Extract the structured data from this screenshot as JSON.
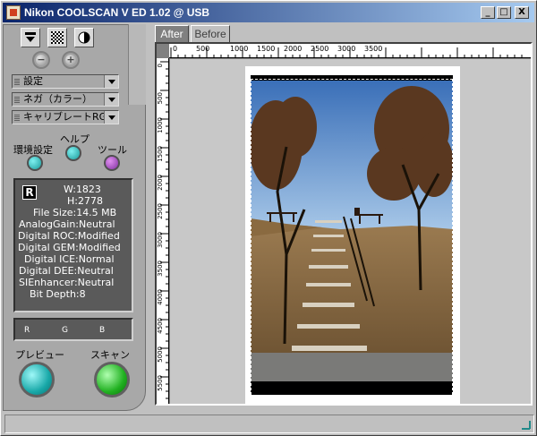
{
  "window": {
    "title": "Nikon COOLSCAN V ED 1.02 @ USB",
    "minimize": "_",
    "maximize": "□",
    "close": "X"
  },
  "panel": {
    "dropdowns": [
      "設定",
      "ネガ（カラー）",
      "キャリブレートRGB"
    ],
    "labels": {
      "env": "環境設定",
      "help": "ヘルプ",
      "tool": "ツール",
      "preview": "プレビュー",
      "scan": "スキャン"
    },
    "zoom_out": "−",
    "zoom_in": "+",
    "info": {
      "badge": "R",
      "w": "W:1823",
      "h": "H:2778",
      "file_size": "File Size:14.5 MB",
      "analog_gain": "AnalogGain:Neutral",
      "roc": "Digital ROC:Modified",
      "gem": "Digital GEM:Modified",
      "ice": "Digital ICE:Normal",
      "dee": "Digital DEE:Neutral",
      "sienhancer": "SIEnhancer:Neutral",
      "bit_depth": "Bit Depth:8"
    },
    "rgb": [
      "R",
      "G",
      "B"
    ]
  },
  "viewer": {
    "tabs": [
      "After",
      "Before"
    ],
    "ruler_top": [
      "0",
      "500",
      "1000",
      "1500",
      "2000",
      "2500",
      "3000",
      "3500"
    ],
    "ruler_left": [
      "0",
      "500",
      "1000",
      "1500",
      "2000",
      "2500",
      "3000",
      "3500",
      "4000",
      "4500",
      "5000",
      "5500"
    ]
  },
  "colors": {
    "title_start": "#0a246a",
    "title_end": "#a6caf0",
    "preview_button": "#18a8a8",
    "scan_button": "#20b020",
    "tool_button": "#8030a0"
  }
}
